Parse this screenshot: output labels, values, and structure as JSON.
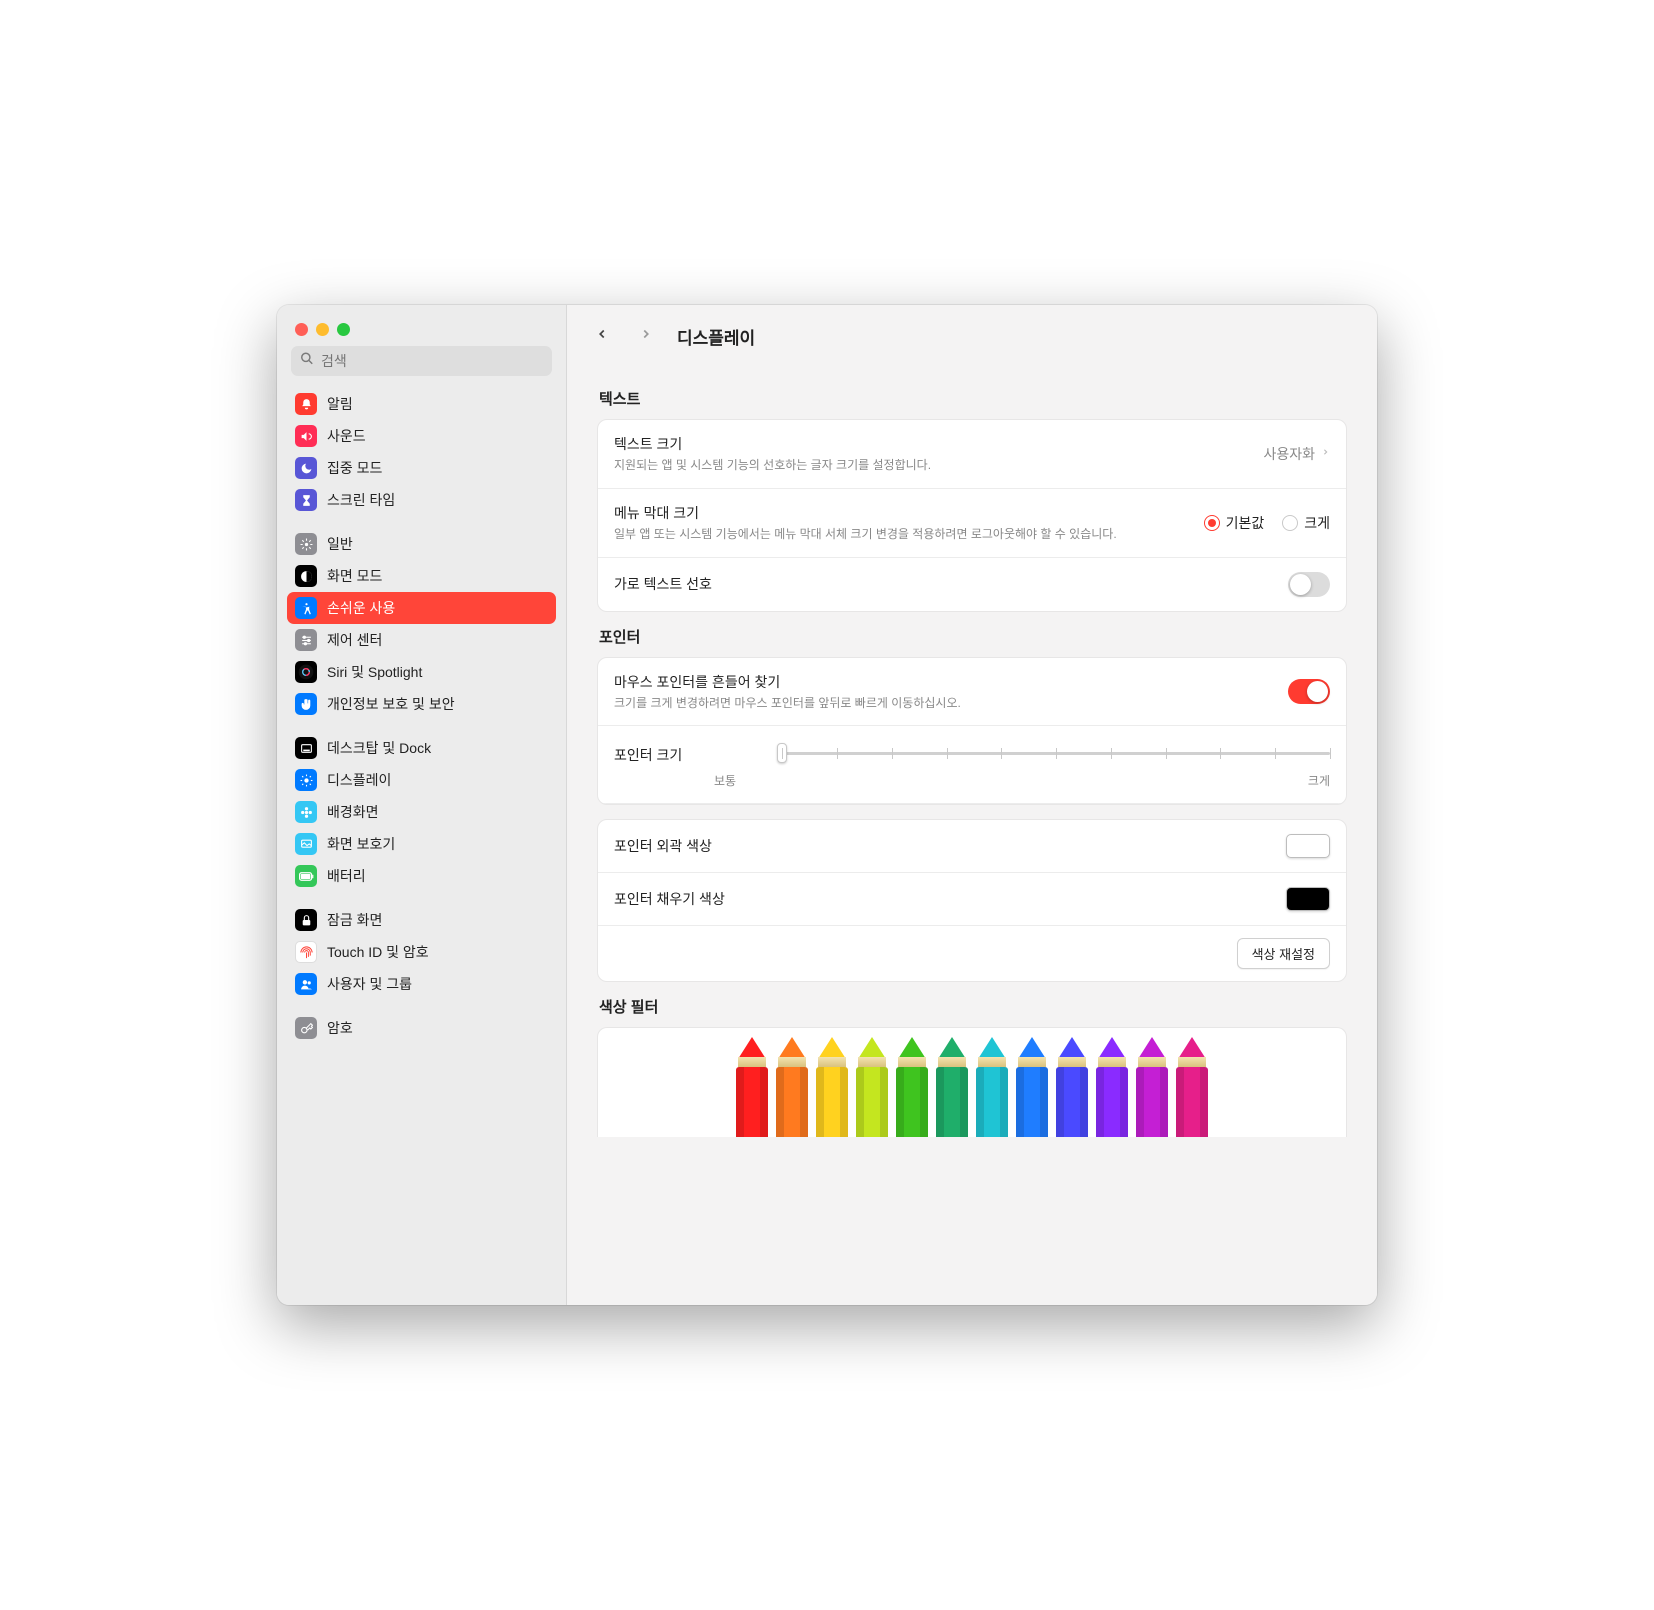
{
  "search": {
    "placeholder": "검색"
  },
  "sidebar": {
    "groups": [
      [
        {
          "label": "알림",
          "icon_bg": "#ff3b30",
          "icon": "bell"
        },
        {
          "label": "사운드",
          "icon_bg": "#ff2d55",
          "icon": "speaker"
        },
        {
          "label": "집중 모드",
          "icon_bg": "#5856d6",
          "icon": "moon"
        },
        {
          "label": "스크린 타임",
          "icon_bg": "#5856d6",
          "icon": "hourglass"
        }
      ],
      [
        {
          "label": "일반",
          "icon_bg": "#8e8e93",
          "icon": "gear"
        },
        {
          "label": "화면 모드",
          "icon_bg": "#000000",
          "icon": "contrast"
        },
        {
          "label": "손쉬운 사용",
          "icon_bg": "#007aff",
          "icon": "accessibility",
          "selected": true
        },
        {
          "label": "제어 센터",
          "icon_bg": "#8e8e93",
          "icon": "sliders"
        },
        {
          "label": "Siri 및 Spotlight",
          "icon_bg": "#000000",
          "icon": "siri"
        },
        {
          "label": "개인정보 보호 및 보안",
          "icon_bg": "#007aff",
          "icon": "hand"
        }
      ],
      [
        {
          "label": "데스크탑 및 Dock",
          "icon_bg": "#000000",
          "icon": "dock"
        },
        {
          "label": "디스플레이",
          "icon_bg": "#007aff",
          "icon": "sun"
        },
        {
          "label": "배경화면",
          "icon_bg": "#34c7f4",
          "icon": "flower"
        },
        {
          "label": "화면 보호기",
          "icon_bg": "#34c7f4",
          "icon": "screensaver"
        },
        {
          "label": "배터리",
          "icon_bg": "#34c759",
          "icon": "battery"
        }
      ],
      [
        {
          "label": "잠금 화면",
          "icon_bg": "#000000",
          "icon": "lock"
        },
        {
          "label": "Touch ID 및 암호",
          "icon_bg": "#ffffff",
          "icon": "fingerprint"
        },
        {
          "label": "사용자 및 그룹",
          "icon_bg": "#007aff",
          "icon": "users"
        }
      ],
      [
        {
          "label": "암호",
          "icon_bg": "#8e8e93",
          "icon": "key"
        }
      ]
    ]
  },
  "header": {
    "title": "디스플레이"
  },
  "sections": {
    "text": {
      "title": "텍스트",
      "text_size": {
        "label": "텍스트 크기",
        "sub": "지원되는 앱 및 시스템 기능의 선호하는 글자 크기를 설정합니다.",
        "value": "사용자화"
      },
      "menubar_size": {
        "label": "메뉴 막대 크기",
        "sub": "일부 앱 또는 시스템 기능에서는 메뉴 막대 서체 크기 변경을 적용하려면 로그아웃해야 할 수 있습니다.",
        "options": [
          "기본값",
          "크게"
        ],
        "selected": 0
      },
      "horizontal_pref": {
        "label": "가로 텍스트 선호",
        "on": false
      }
    },
    "pointer": {
      "title": "포인터",
      "shake": {
        "label": "마우스 포인터를 흔들어 찾기",
        "sub": "크기를 크게 변경하려면 마우스 포인터를 앞뒤로 빠르게 이동하십시오.",
        "on": true
      },
      "size": {
        "label": "포인터 크기",
        "min_label": "보통",
        "max_label": "크게",
        "value": 0
      },
      "outline": {
        "label": "포인터 외곽 색상",
        "color": "#ffffff"
      },
      "fill": {
        "label": "포인터 채우기 색상",
        "color": "#000000"
      },
      "reset": "색상 재설정"
    },
    "color_filters": {
      "title": "색상 필터",
      "pencil_colors": [
        "#ff1f1f",
        "#ff7a1f",
        "#ffd21f",
        "#c4e61f",
        "#3fc41f",
        "#1fae6a",
        "#1fc4d4",
        "#1f7dff",
        "#4a4aff",
        "#8a2bff",
        "#c41fd4",
        "#e61f8a"
      ]
    }
  }
}
